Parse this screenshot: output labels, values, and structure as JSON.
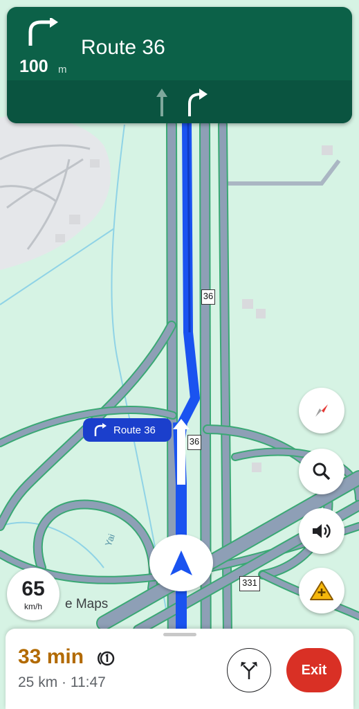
{
  "navigation": {
    "distance_value": "100",
    "distance_unit": "m",
    "street_name": "Route 36",
    "turn_icon": "turn-right-icon",
    "lanes": [
      "straight-arrow-icon",
      "turn-right-icon"
    ]
  },
  "map": {
    "route_callout": "Route 36",
    "shield_labels": [
      "36",
      "36",
      "331"
    ],
    "water_label": "Yai",
    "attribution": "e Maps"
  },
  "controls": {
    "compass_icon": "compass-icon",
    "search_icon": "search-icon",
    "volume_icon": "volume-icon",
    "report_icon": "report-hazard-icon"
  },
  "speed": {
    "value": "65",
    "unit": "km/h"
  },
  "trip": {
    "duration": "33 min",
    "toll_icon": "toll-icon",
    "distance_time": "25 km · 11:47",
    "exit_label": "Exit",
    "alt_routes_icon": "alternate-routes-icon"
  },
  "colors": {
    "banner": "#0c6148",
    "route": "#1a53f0",
    "exit": "#d93025",
    "eta": "#b26a00"
  }
}
